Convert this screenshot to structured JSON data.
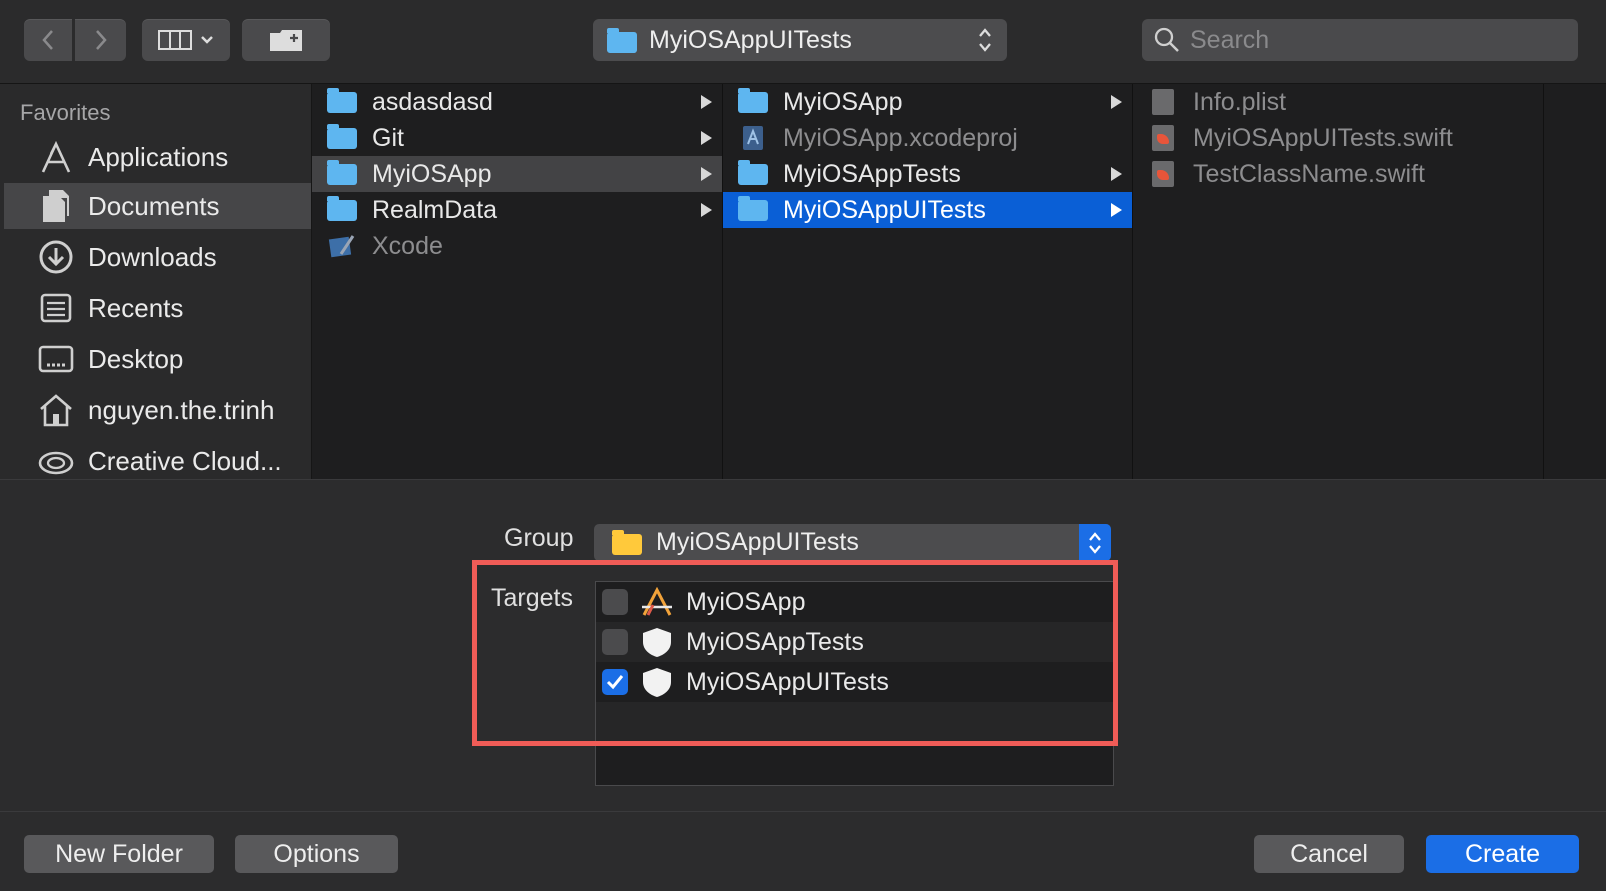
{
  "toolbar": {
    "path_title": "MyiOSAppUITests",
    "search_placeholder": "Search"
  },
  "sidebar": {
    "heading": "Favorites",
    "items": [
      {
        "label": "Applications",
        "icon": "applications-icon"
      },
      {
        "label": "Documents",
        "icon": "documents-icon",
        "selected": true
      },
      {
        "label": "Downloads",
        "icon": "downloads-icon"
      },
      {
        "label": "Recents",
        "icon": "recents-icon"
      },
      {
        "label": "Desktop",
        "icon": "desktop-icon"
      },
      {
        "label": "nguyen.the.trinh",
        "icon": "home-icon"
      },
      {
        "label": "Creative Cloud...",
        "icon": "creative-cloud-icon"
      }
    ]
  },
  "columns": {
    "col1": [
      "asdasdasd",
      "Git",
      "MyiOSApp",
      "RealmData",
      "Xcode"
    ],
    "col2": [
      "MyiOSApp",
      "MyiOSApp.xcodeproj",
      "MyiOSAppTests",
      "MyiOSAppUITests"
    ],
    "col3": [
      "Info.plist",
      "MyiOSAppUITests.swift",
      "TestClassName.swift"
    ]
  },
  "form": {
    "group_label": "Group",
    "group_value": "MyiOSAppUITests",
    "targets_label": "Targets",
    "targets": [
      {
        "name": "MyiOSApp",
        "checked": false
      },
      {
        "name": "MyiOSAppTests",
        "checked": false
      },
      {
        "name": "MyiOSAppUITests",
        "checked": true
      }
    ]
  },
  "buttons": {
    "new_folder": "New Folder",
    "options": "Options",
    "cancel": "Cancel",
    "create": "Create"
  },
  "colors": {
    "accent": "#1b6ee6",
    "highlight_box": "#f05c57"
  }
}
